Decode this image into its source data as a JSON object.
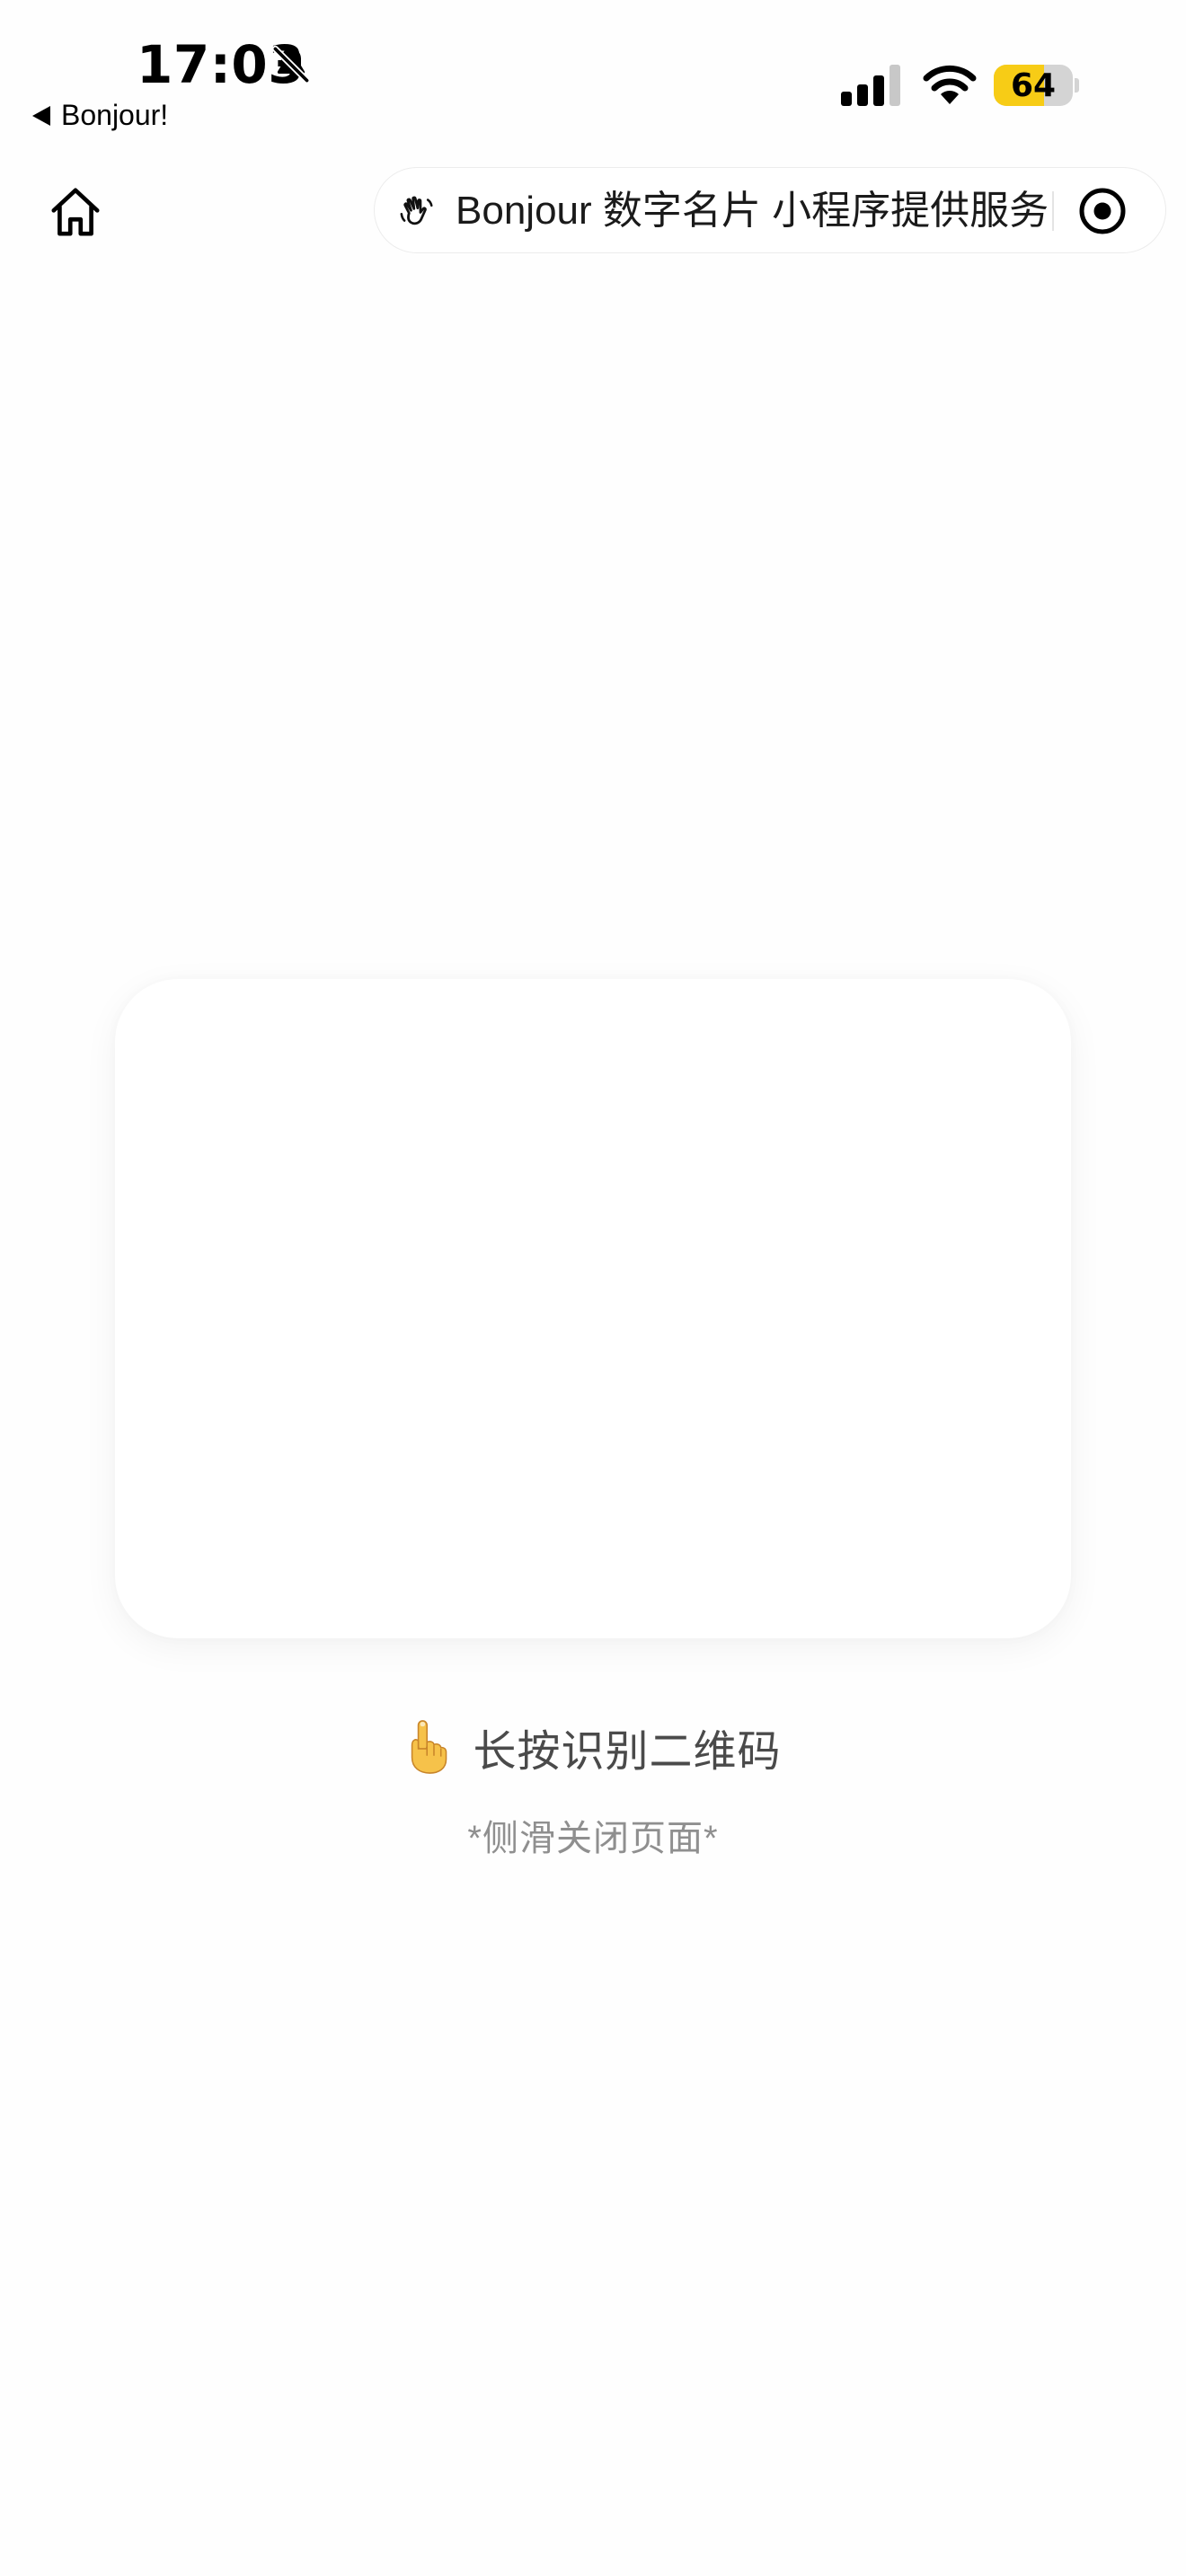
{
  "status_bar": {
    "time": "17:03",
    "back_app_label": "Bonjour!",
    "battery_percent": "64",
    "battery_level": 0.64,
    "battery_color": "#f7cc16"
  },
  "nav": {
    "capsule_text": "Bonjour 数字名片 小程序提供服务"
  },
  "main": {
    "hint": "长按识别二维码",
    "sub_hint": "*侧滑关闭页面*"
  },
  "icons": {
    "bell": "bell-slash-icon",
    "signal": "signal-icon",
    "wifi": "wifi-icon",
    "home": "home-icon",
    "wave": "waving-hand-icon",
    "close": "close-circle-icon",
    "pointer": "pointing-finger-icon"
  }
}
